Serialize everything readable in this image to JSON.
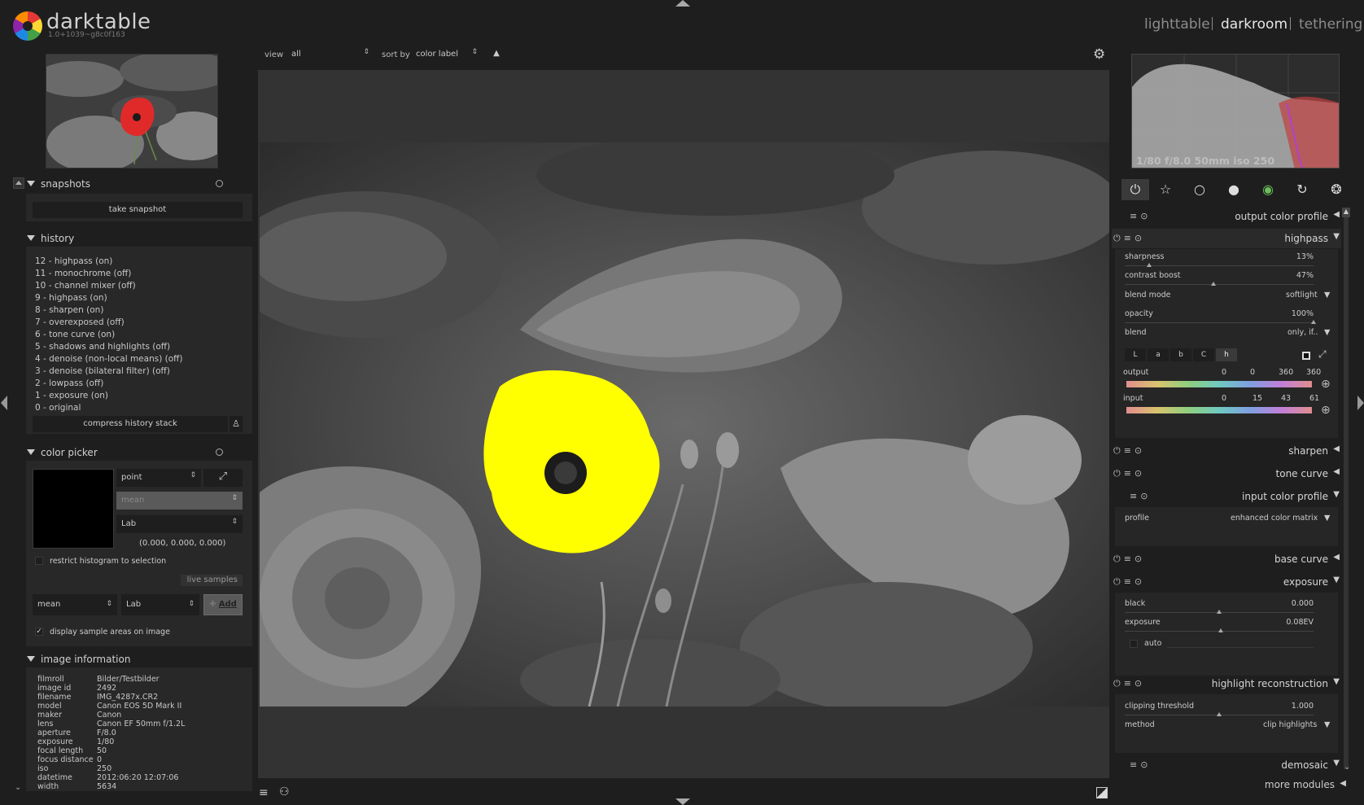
{
  "app": {
    "name": "darktable",
    "version": "1.0+1039~g8c0f163"
  },
  "views": [
    {
      "label": "lighttable"
    },
    {
      "label": "darkroom"
    },
    {
      "label": "tethering"
    }
  ],
  "active_view": "darkroom",
  "toolbar": {
    "view_label": "view",
    "view_value": "all",
    "sort_label": "sort by",
    "sort_value": "color label",
    "sort_direction": "▲"
  },
  "snapshots": {
    "title": "snapshots",
    "take_button": "take snapshot"
  },
  "history": {
    "title": "history",
    "items": [
      "12 - highpass (on)",
      "11 - monochrome (off)",
      "10 - channel mixer (off)",
      "9 - highpass (on)",
      "8 - sharpen (on)",
      "7 - overexposed (off)",
      "6 - tone curve (on)",
      "5 - shadows and highlights (off)",
      "4 - denoise (non-local means) (off)",
      "3 - denoise (bilateral filter) (off)",
      "2 - lowpass (off)",
      "1 - exposure (on)",
      "0 - original"
    ],
    "compress_button": "compress history stack"
  },
  "color_picker": {
    "title": "color picker",
    "mode": "point",
    "statistic": "mean",
    "colorspace": "Lab",
    "readout": "(0.000, 0.000, 0.000)",
    "restrict_label": "restrict histogram to selection",
    "live_samples_label": "live samples",
    "sample_statistic": "mean",
    "sample_colorspace": "Lab",
    "add_button": "Add",
    "display_samples_label": "display sample areas on image",
    "display_samples_checked": true
  },
  "image_information": {
    "title": "image information",
    "rows": [
      {
        "k": "filmroll",
        "v": "Bilder/Testbilder"
      },
      {
        "k": "image id",
        "v": "2492"
      },
      {
        "k": "filename",
        "v": "IMG_4287x.CR2"
      },
      {
        "k": "model",
        "v": "Canon EOS 5D Mark II"
      },
      {
        "k": "maker",
        "v": "Canon"
      },
      {
        "k": "lens",
        "v": "Canon EF 50mm f/1.2L"
      },
      {
        "k": "aperture",
        "v": "F/8.0"
      },
      {
        "k": "exposure",
        "v": "1/80"
      },
      {
        "k": "focal length",
        "v": "50"
      },
      {
        "k": "focus distance",
        "v": "0"
      },
      {
        "k": "iso",
        "v": "250"
      },
      {
        "k": "datetime",
        "v": "2012:06:20 12:07:06"
      },
      {
        "k": "width",
        "v": "5634"
      }
    ]
  },
  "histogram": {
    "info": "1/80 f/8.0 50mm iso 250"
  },
  "module_groups": [
    "power-icon",
    "star-icon",
    "circle-icon",
    "sphere-icon",
    "color-icon",
    "rotate-icon",
    "aperture-icon"
  ],
  "modules": {
    "output_color_profile": "output color profile",
    "highpass": {
      "name": "highpass",
      "sharpness_label": "sharpness",
      "sharpness_value": "13%",
      "sharpness_level": 0.13,
      "contrast_label": "contrast boost",
      "contrast_value": "47%",
      "contrast_level": 0.47,
      "blend_mode_label": "blend mode",
      "blend_mode_value": "softlight",
      "opacity_label": "opacity",
      "opacity_value": "100%",
      "opacity_level": 1.0,
      "blend_label": "blend",
      "blend_value": "only, if..",
      "channels": [
        "L",
        "a",
        "b",
        "C",
        "h"
      ],
      "active_channel": "h",
      "output_label": "output",
      "output_values": [
        "0",
        "0",
        "360",
        "360"
      ],
      "input_label": "input",
      "input_values": [
        "0",
        "15",
        "43",
        "61"
      ]
    },
    "sharpen": "sharpen",
    "tone_curve": "tone curve",
    "input_color_profile": {
      "name": "input color profile",
      "profile_label": "profile",
      "profile_value": "enhanced color matrix"
    },
    "base_curve": "base curve",
    "exposure": {
      "name": "exposure",
      "black_label": "black",
      "black_value": "0.000",
      "black_level": 0.5,
      "exposure_label": "exposure",
      "exposure_value": "0.08EV",
      "exposure_level": 0.51,
      "auto_label": "auto"
    },
    "highlight_reconstruction": {
      "name": "highlight reconstruction",
      "clip_label": "clipping threshold",
      "clip_value": "1.000",
      "clip_level": 0.5,
      "method_label": "method",
      "method_value": "clip highlights"
    },
    "demosaic": "demosaic",
    "more_modules": "more modules"
  },
  "colors": {
    "accent_yellow": "#ffff00",
    "panel": "#282828",
    "background": "#1e1e1e"
  }
}
